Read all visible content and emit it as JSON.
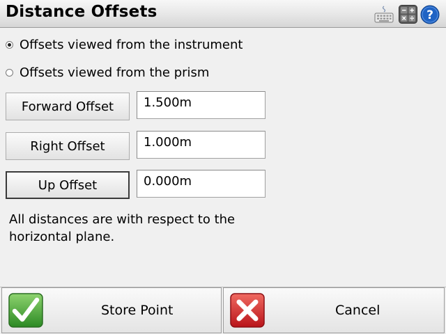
{
  "window": {
    "title": "Distance Offsets",
    "icons": [
      "keyboard-icon",
      "calculator-icon",
      "help-icon"
    ]
  },
  "view_options": [
    {
      "label": "Offsets viewed from the instrument",
      "selected": true
    },
    {
      "label": "Offsets viewed from the prism",
      "selected": false
    }
  ],
  "offsets": {
    "forward": {
      "label": "Forward Offset",
      "value": "1.500m"
    },
    "right": {
      "label": "Right Offset",
      "value": "1.000m"
    },
    "up": {
      "label": "Up Offset",
      "value": "0.000m"
    }
  },
  "note": "All distances are with respect to the horizontal plane.",
  "footer": {
    "store_label": "Store Point",
    "cancel_label": "Cancel"
  },
  "colors": {
    "help_blue": "#1f63c4",
    "ok_green": "#3fa535",
    "cancel_red": "#d8242a"
  }
}
